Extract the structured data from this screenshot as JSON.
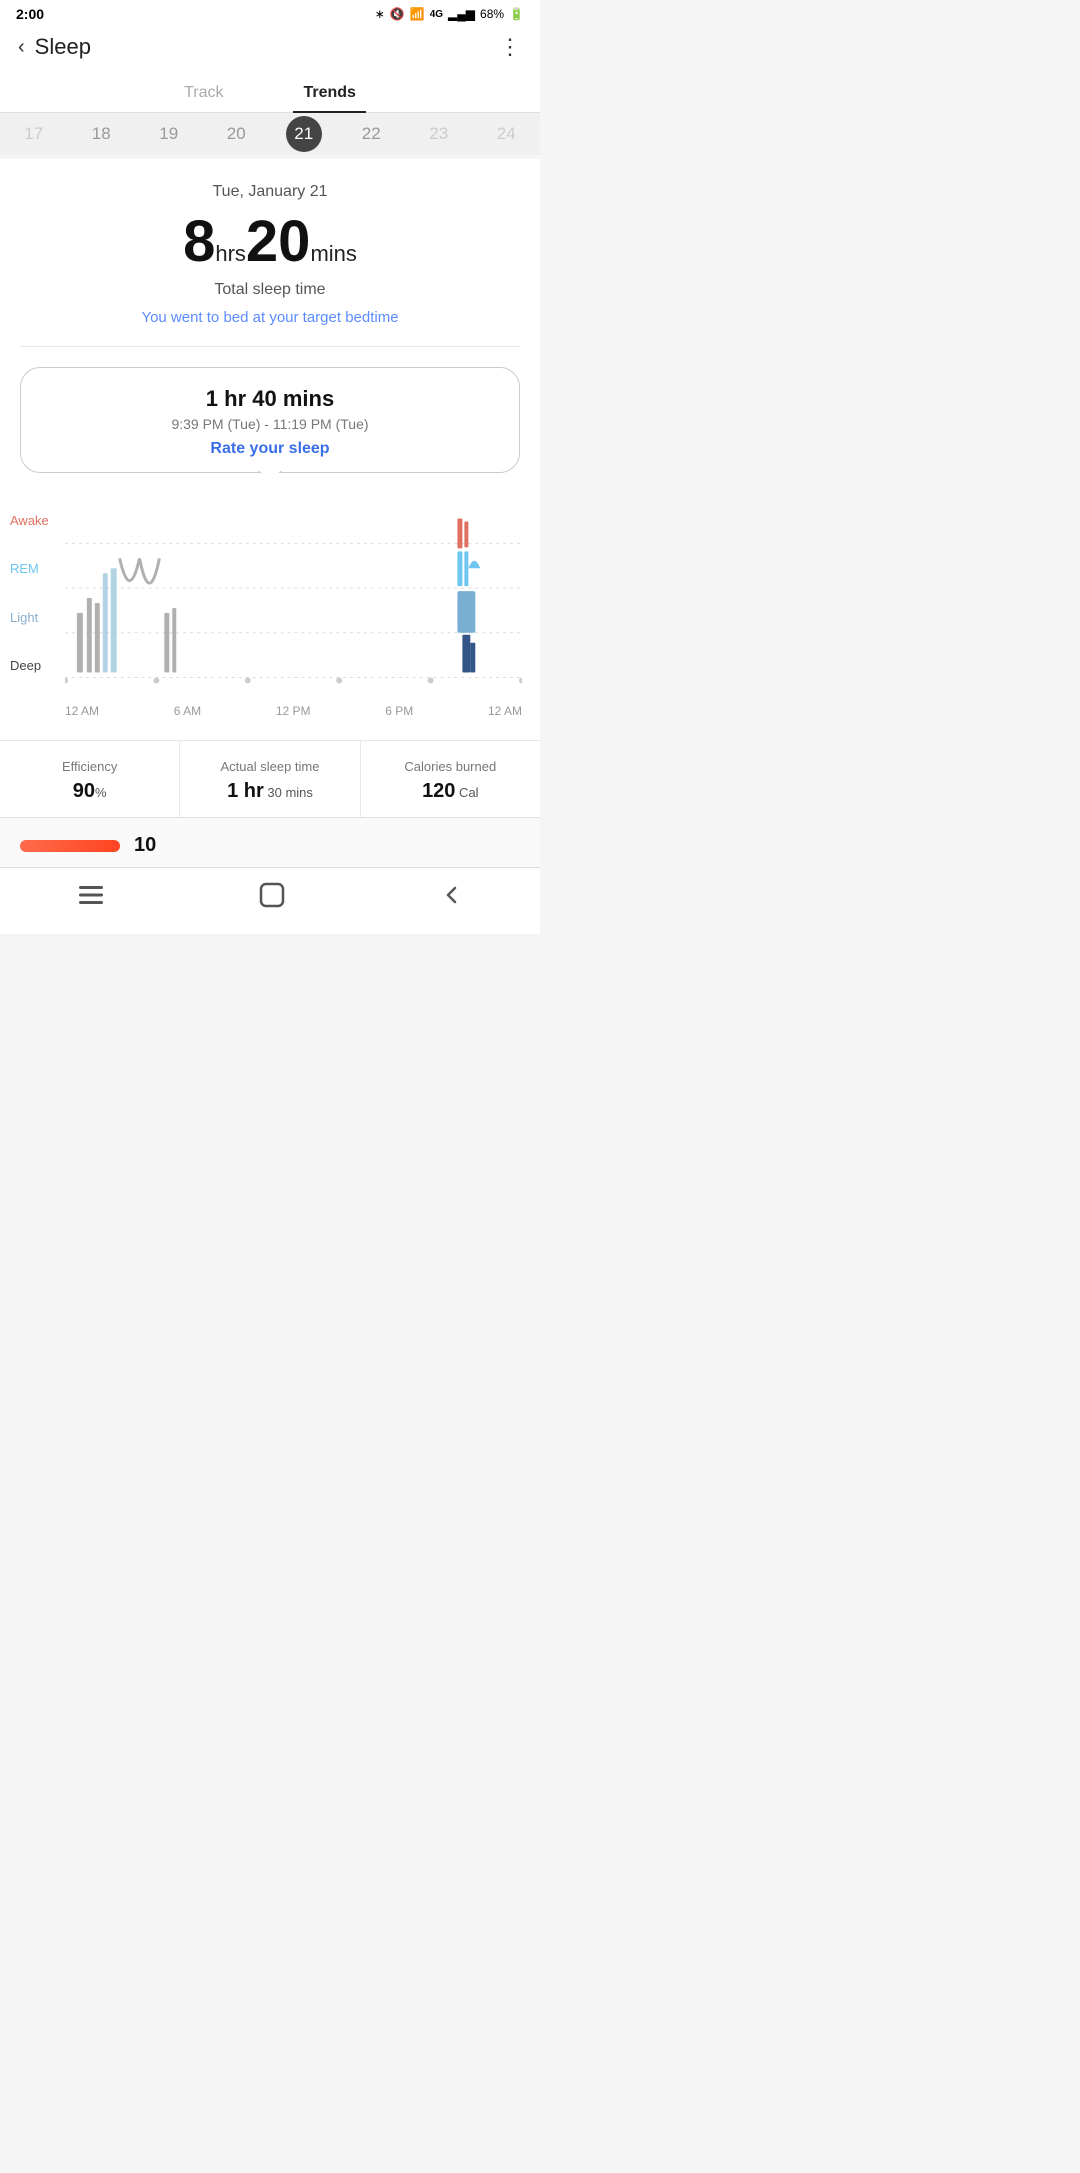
{
  "statusBar": {
    "time": "2:00",
    "batteryPct": "68%",
    "icons": [
      "bluetooth",
      "mute",
      "wifi",
      "4g",
      "signal",
      "battery"
    ]
  },
  "header": {
    "backLabel": "‹",
    "title": "Sleep",
    "moreIcon": "⋮"
  },
  "tabs": [
    {
      "id": "track",
      "label": "Track",
      "active": false
    },
    {
      "id": "trends",
      "label": "Trends",
      "active": true
    }
  ],
  "dateScrubber": {
    "dates": [
      {
        "num": "17",
        "dim": true
      },
      {
        "num": "18",
        "dim": false
      },
      {
        "num": "19",
        "dim": false
      },
      {
        "num": "20",
        "dim": false
      },
      {
        "num": "21",
        "active": true
      },
      {
        "num": "22",
        "dim": false
      },
      {
        "num": "23",
        "dim": true
      },
      {
        "num": "24",
        "dim": true
      }
    ]
  },
  "sleepSummary": {
    "dateLabel": "Tue, January 21",
    "hours": "8",
    "hrsUnit": "hrs",
    "mins": "20",
    "minsUnit": "mins",
    "totalLabel": "Total sleep time",
    "targetMsg": "You went to bed at your target bedtime"
  },
  "sessionCard": {
    "duration": "1 hr 40 mins",
    "timeRange": "9:39 PM (Tue) - 11:19 PM (Tue)",
    "rateLabel": "Rate your sleep"
  },
  "sleepChart": {
    "stages": [
      "Awake",
      "REM",
      "Light",
      "Deep"
    ],
    "timeLabels": [
      "12 AM",
      "6 AM",
      "12 PM",
      "6 PM",
      "12 AM"
    ],
    "colors": {
      "awake": "#e07060",
      "rem": "#6ec6f0",
      "light": "#8ab0d0",
      "deep": "#335588"
    }
  },
  "stats": [
    {
      "id": "efficiency",
      "label": "Efficiency",
      "value": "90",
      "unit": "%"
    },
    {
      "id": "actual-sleep",
      "label": "Actual sleep time",
      "value": "1 hr",
      "unit": " 30 mins"
    },
    {
      "id": "calories",
      "label": "Calories burned",
      "value": "120",
      "unit": " Cal"
    }
  ],
  "navBar": {
    "items": [
      "menu-icon",
      "home-icon",
      "back-icon"
    ]
  }
}
